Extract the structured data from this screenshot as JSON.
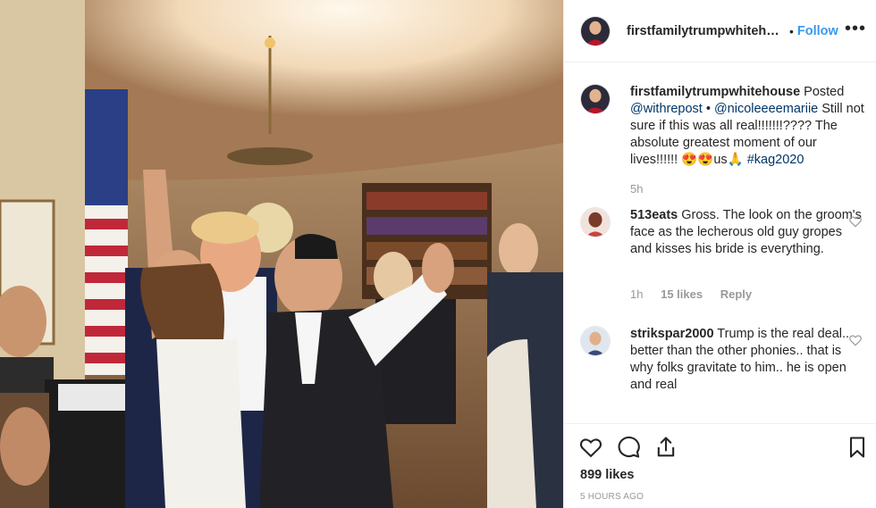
{
  "post": {
    "username": "firstfamilytrumpwhitehouse",
    "follow_label": "Follow",
    "separator": "•",
    "more_label": "•••",
    "caption": {
      "username": "firstfamilytrumpwhitehouse",
      "verb": "Posted",
      "mention1": "@withrepost",
      "sep": "•",
      "mention2": "@nicoleeeemariie",
      "text": "Still not sure if this was all real!!!!!!!???? The absolute greatest moment of our lives!!!!!! 😍😍us🙏",
      "hashtag": "#kag2020",
      "time": "5h"
    },
    "comments": [
      {
        "username": "513eats",
        "text": "Gross. The look on the groom's face as the lecherous old guy gropes and kisses his bride is everything.",
        "time": "1h",
        "likes": "15 likes",
        "reply_label": "Reply"
      },
      {
        "username": "strikspar2000",
        "text": "Trump is the real deal.. better than the other phonies.. that is why folks gravitate to him.. he is open and real"
      }
    ],
    "likes": "899 likes",
    "timestamp": "5 HOURS AGO"
  },
  "icons": {
    "like": "heart-icon",
    "comment": "comment-icon",
    "share": "share-icon",
    "save": "bookmark-icon"
  },
  "colors": {
    "link": "#3897f0",
    "mention": "#003569",
    "muted": "#999999"
  }
}
